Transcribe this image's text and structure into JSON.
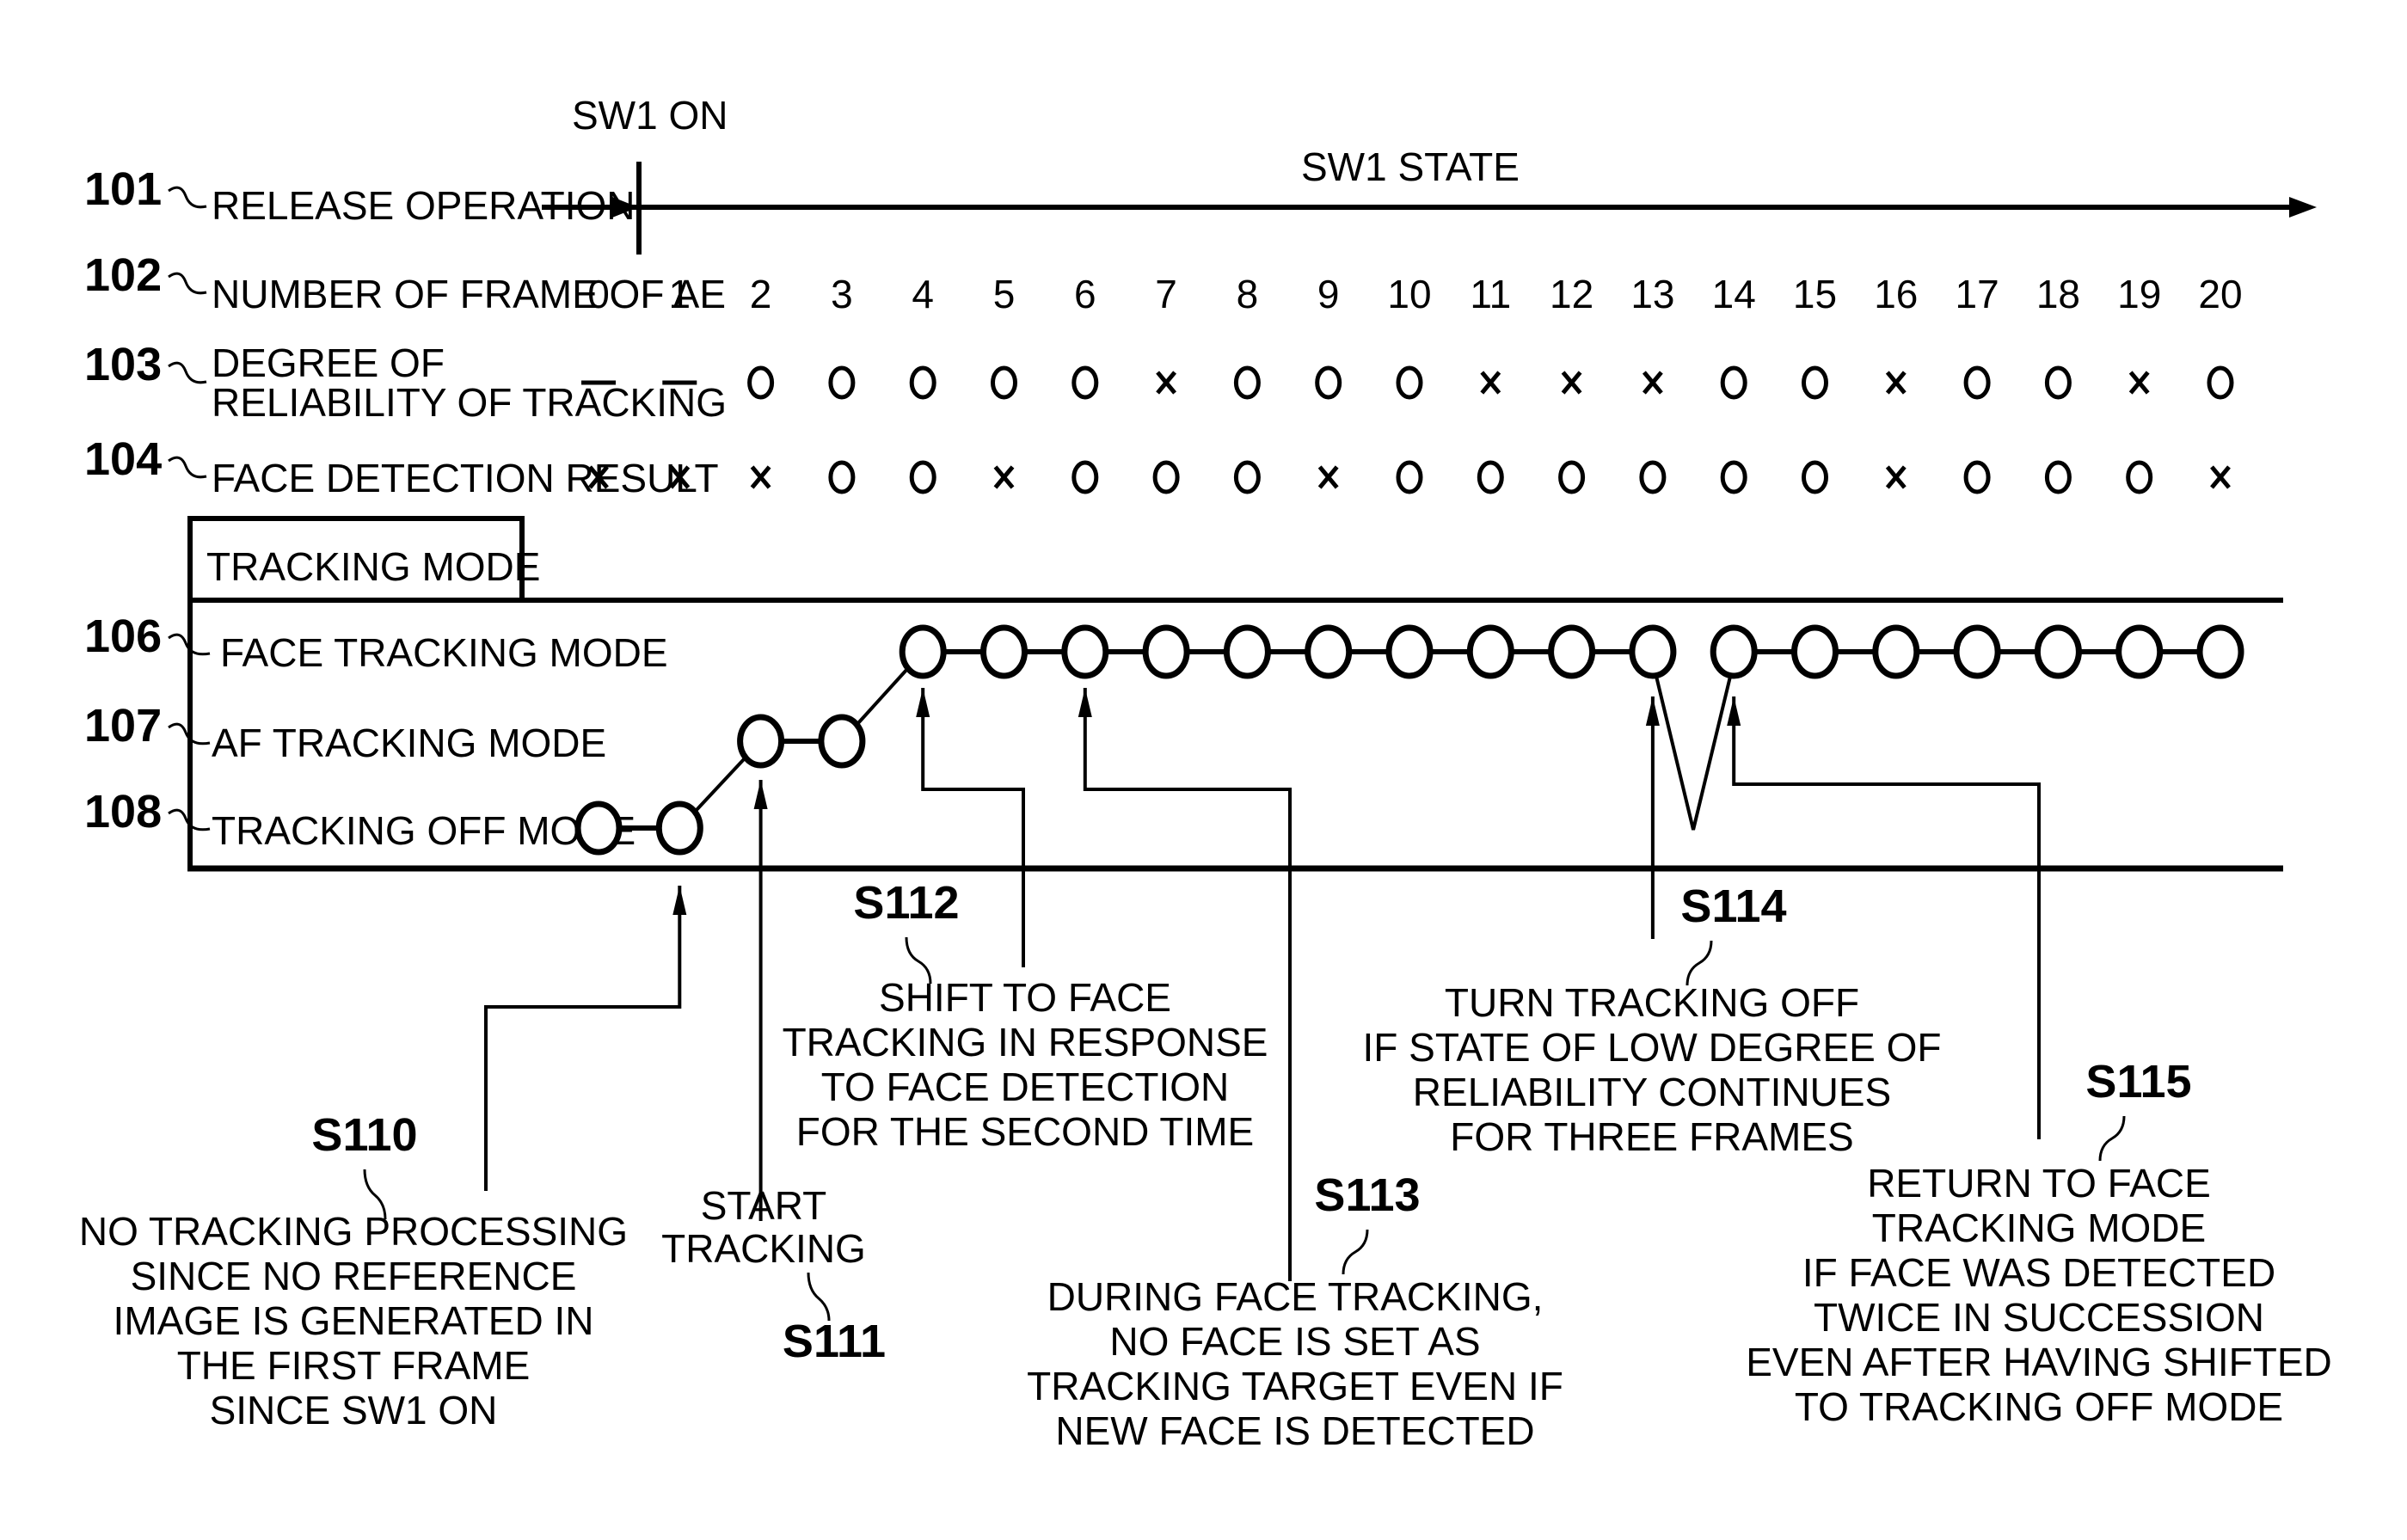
{
  "figure": {
    "sw1_on_label": "SW1 ON",
    "sw1_state_label": "SW1 STATE",
    "rows": [
      {
        "ref": "101",
        "label": [
          "RELEASE OPERATION"
        ]
      },
      {
        "ref": "102",
        "label": [
          "NUMBER OF FRAME OF AE"
        ]
      },
      {
        "ref": "103",
        "label": [
          "DEGREE OF",
          "RELIABILITY OF TRACKING"
        ]
      },
      {
        "ref": "104",
        "label": [
          "FACE DETECTION RESULT"
        ]
      }
    ],
    "tracking_mode_title": "TRACKING MODE",
    "modes": [
      {
        "ref": "106",
        "key": "face",
        "label": "FACE TRACKING MODE"
      },
      {
        "ref": "107",
        "key": "af",
        "label": "AF TRACKING MODE"
      },
      {
        "ref": "108",
        "key": "off",
        "label": "TRACKING OFF MODE"
      }
    ],
    "legend_symbols": {
      "good": "O",
      "bad": "x",
      "none": "-"
    }
  },
  "timeline": {
    "frames": [
      0,
      1,
      2,
      3,
      4,
      5,
      6,
      7,
      8,
      9,
      10,
      11,
      12,
      13,
      14,
      15,
      16,
      17,
      18,
      19,
      20
    ],
    "tracking_reliability": [
      "-",
      "-",
      "O",
      "O",
      "O",
      "O",
      "O",
      "x",
      "O",
      "O",
      "O",
      "x",
      "x",
      "x",
      "O",
      "O",
      "x",
      "O",
      "O",
      "x",
      "O"
    ],
    "face_detection": [
      "x",
      "x",
      "x",
      "O",
      "O",
      "x",
      "O",
      "O",
      "O",
      "x",
      "O",
      "O",
      "O",
      "O",
      "O",
      "O",
      "x",
      "O",
      "O",
      "O",
      "x"
    ],
    "tracking_mode": [
      "off",
      "off",
      "af",
      "af",
      "face",
      "face",
      "face",
      "face",
      "face",
      "face",
      "face",
      "face",
      "face",
      "face",
      "face",
      "face",
      "face",
      "face",
      "face",
      "face",
      "face"
    ],
    "mode_break_between": [
      13,
      14
    ]
  },
  "annotations": [
    {
      "step": "S110",
      "frame": 1,
      "lines": [
        "NO TRACKING PROCESSING",
        "SINCE NO REFERENCE",
        "IMAGE IS GENERATED IN",
        "THE FIRST FRAME",
        "SINCE SW1 ON"
      ]
    },
    {
      "step": "S111",
      "frame": 2,
      "lines": [
        "START",
        "TRACKING"
      ]
    },
    {
      "step": "S112",
      "frame": 4,
      "lines": [
        "SHIFT TO FACE",
        "TRACKING IN RESPONSE",
        "TO FACE DETECTION",
        "FOR THE SECOND TIME"
      ]
    },
    {
      "step": "S113",
      "frame": 6,
      "lines": [
        "DURING FACE TRACKING,",
        "NO FACE IS SET AS",
        "TRACKING TARGET EVEN IF",
        "NEW FACE IS DETECTED"
      ]
    },
    {
      "step": "S114",
      "frame": 13,
      "lines": [
        "TURN TRACKING OFF",
        "IF STATE OF LOW DEGREE OF",
        "RELIABILITY CONTINUES",
        "FOR THREE FRAMES"
      ]
    },
    {
      "step": "S115",
      "frame": 14,
      "lines": [
        "RETURN TO FACE",
        "TRACKING MODE",
        "IF FACE WAS DETECTED",
        "TWICE IN SUCCESSION",
        "EVEN AFTER HAVING SHIFTED",
        "TO TRACKING OFF MODE"
      ]
    }
  ]
}
